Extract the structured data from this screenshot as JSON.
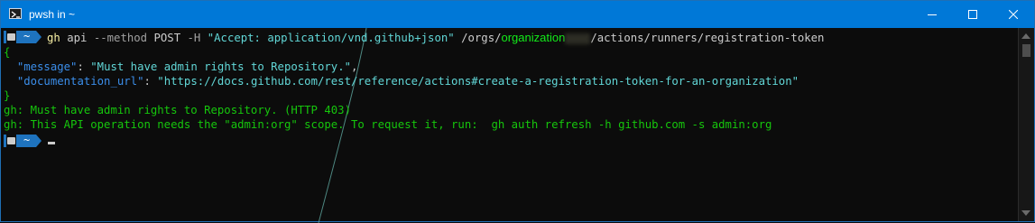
{
  "window": {
    "title": "pwsh in ~",
    "icon": "powershell-icon",
    "controls": {
      "minimize_icon": "minimize-icon",
      "maximize_icon": "maximize-icon",
      "close_icon": "close-icon"
    }
  },
  "prompt": {
    "symbol": "~",
    "icons": [
      "folder-icon",
      "home-icon"
    ],
    "bg_color": "#1e73be"
  },
  "command": {
    "program": "gh",
    "sub": "api",
    "flag1": "--method",
    "method": "POST",
    "flag2": "-H",
    "header": "\"Accept: application/vnd.github+json\"",
    "path_prefix": "/orgs/",
    "org": "organization",
    "path_suffix": "/actions/runners/registration-token"
  },
  "response": {
    "open_brace": "{",
    "message_key": "\"message\"",
    "message_sep": ": ",
    "message_value": "\"Must have admin rights to Repository.\"",
    "message_comma": ",",
    "doc_key": "\"documentation_url\"",
    "doc_sep": ": ",
    "doc_value": "\"https://docs.github.com/rest/reference/actions#create-a-registration-token-for-an-organization\"",
    "close_brace": "}"
  },
  "errors": [
    "gh: Must have admin rights to Repository. (HTTP 403)",
    "gh: This API operation needs the \"admin:org\" scope. To request it, run:  gh auth refresh -h github.com -s admin:org"
  ],
  "colors": {
    "titlebar": "#0078d7",
    "terminal_bg": "#0c0c0c",
    "error_green": "#16c60c",
    "json_key_blue": "#3b8eea",
    "string_cyan": "#61d6d6",
    "command_yellow": "#f9f1a5"
  }
}
